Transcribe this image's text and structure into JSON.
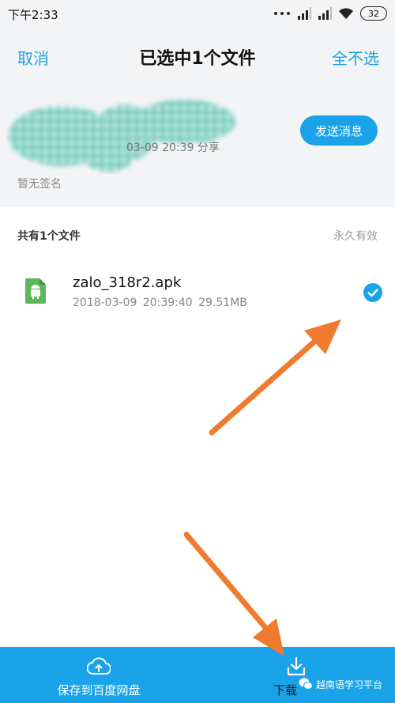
{
  "status": {
    "time": "下午2:33",
    "battery": "32",
    "icons": [
      "dots-icon",
      "signal-icon",
      "signal-icon",
      "wifi-icon",
      "battery-icon"
    ]
  },
  "header": {
    "cancel": "取消",
    "title": "已选中1个文件",
    "select_toggle": "全不选"
  },
  "sender": {
    "meta": "03-09 20:39  分享",
    "send_message": "发送消息",
    "signature": "暂无签名"
  },
  "files": {
    "count_label": "共有1个文件",
    "validity": "永久有效",
    "items": [
      {
        "name": "zalo_318r2.apk",
        "meta": "2018-03-09  20:39:40   29.51MB",
        "icon": "android-file-icon",
        "checked": true
      }
    ]
  },
  "bottom_bar": {
    "save_label": "保存到百度网盘",
    "download_label": "下载"
  },
  "watermark": "越南语学习平台",
  "colors": {
    "accent": "#1aa3e8",
    "link": "#1aa3de",
    "annotation_arrow": "#f07a2e",
    "blob": "#7fd1c3"
  }
}
